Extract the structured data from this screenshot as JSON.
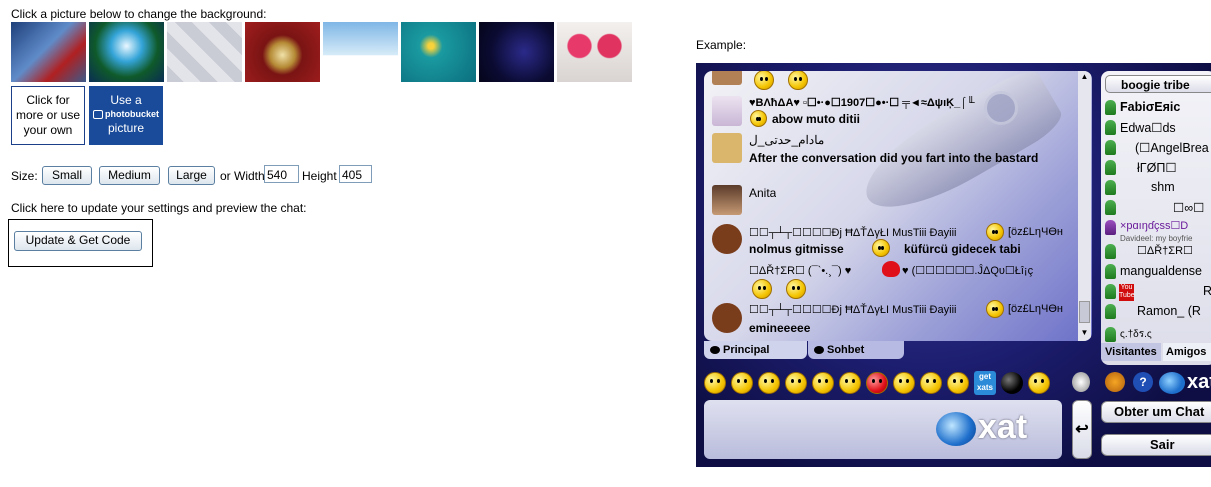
{
  "settings": {
    "instruction": "Click a picture below to change the background:",
    "custom_button": "Click for more or use your own",
    "photobucket_use": "Use a",
    "photobucket_logo": "photobucket",
    "photobucket_picture": "picture",
    "size_label": "Size:",
    "size_small": "Small",
    "size_medium": "Medium",
    "size_large": "Large",
    "or_width": "or Width",
    "width_value": "540",
    "height_label": "Height",
    "height_value": "405",
    "update_instruction": "Click here to update your settings and preview the chat:",
    "update_button": "Update & Get Code"
  },
  "example": {
    "label": "Example:",
    "group_name": "boogie tribe",
    "messages": [
      {
        "text": "♥ΒΛħΔΑ♥  ▫☐•·●☐1907☐●•·☐   ╤◄≈ΔψıĶ_⌠╙",
        "bold": true,
        "color": "#00008b"
      },
      {
        "text": "abow muto ditii",
        "bold": true,
        "color": "#000000"
      },
      {
        "text": "مادام_حدتی_ل",
        "bold": false,
        "color": "#000000"
      },
      {
        "text": "After the conversation did you fart into the bastard",
        "bold": true,
        "color": "#000000"
      },
      {
        "text": "Anita",
        "bold": false,
        "color": "#000000"
      },
      {
        "text": "☐☐┬┴┬☐☐☐☐Đj ĦΔŤΔγŁI ΜusTiii Đayiii",
        "bold": false,
        "color": "#000000"
      },
      {
        "text": "[öz£LηЧӨн",
        "bold": false,
        "color": "#000000"
      },
      {
        "text": "nolmus gitmisse",
        "bold": true,
        "color": "#000000"
      },
      {
        "text": "küfürcü gidecek tabi",
        "bold": true,
        "color": "#000000"
      },
      {
        "text": "☐ΔŘ†ΣR☐ (¯`•.¸¯) ♥",
        "bold": false,
        "color": "#000000"
      },
      {
        "text": "♥ (☐☐☐☐☐☐.ĴΔQυ☐Łî¡ç",
        "bold": false,
        "color": "#000000"
      },
      {
        "text": "☐☐┬┴┬☐☐☐☐Đj ĦΔŤΔγŁI ΜusTiii Đayiii",
        "bold": false,
        "color": "#000000"
      },
      {
        "text": "[öz£LηЧӨн",
        "bold": false,
        "color": "#000000"
      },
      {
        "text": "emineeeee",
        "bold": true,
        "color": "#000000"
      }
    ],
    "tabs": [
      "Principal",
      "Sohbet"
    ],
    "users": [
      {
        "name": "FabiσΕяic",
        "bold": true
      },
      {
        "name": "Edwa☐ds",
        "bold": false
      },
      {
        "name": "(☐AngelBrea",
        "bold": false
      },
      {
        "name": "łΓØΠ☐",
        "bold": false
      },
      {
        "name": "shm",
        "bold": false
      },
      {
        "name": "☐∞☐",
        "bold": false
      },
      {
        "name": "×pɑıŋɗçss☐D",
        "bold": false
      },
      {
        "name": "Davideel: my boyfrie",
        "bold": false
      },
      {
        "name": "☐ΔŘ†ΣR☐",
        "bold": false
      },
      {
        "name": "mangualdense",
        "bold": false
      },
      {
        "name": "R",
        "bold": false
      },
      {
        "name": "Ramon_ (R",
        "bold": false
      },
      {
        "name": "ς.†δร.ς",
        "bold": false
      }
    ],
    "user_tabs": [
      "Visitantes",
      "Amigos"
    ],
    "get_xats_label": "get xats",
    "xat_logo": "xat",
    "obter_button": "Obter um Chat",
    "sair_button": "Sair",
    "send_icon": "↩"
  }
}
